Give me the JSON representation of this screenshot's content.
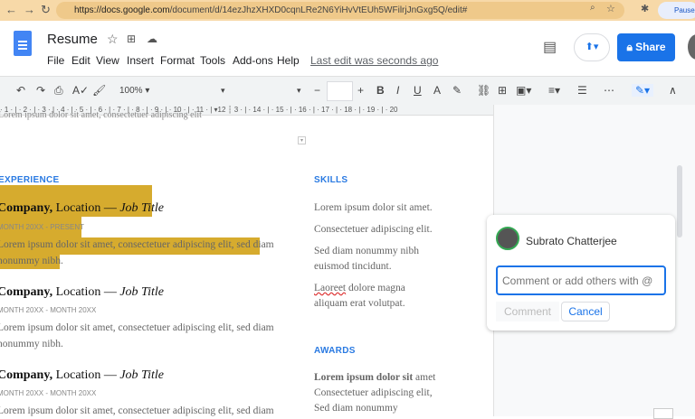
{
  "browser": {
    "url_host": "https://docs.google.com",
    "url_path": "/document/d/14ezJhzXHXD0cqnLRe2N6YiHvVtEUh5WFilrjJnGxg5Q/edit#",
    "profile": "Paused"
  },
  "doc": {
    "title": "Resume",
    "menu": [
      "File",
      "Edit",
      "View",
      "Insert",
      "Format",
      "Tools",
      "Add-ons",
      "Help"
    ],
    "last_edit": "Last edit was seconds ago",
    "share": "Share"
  },
  "toolbar": {
    "zoom": "100%",
    "minus": "−",
    "plus": "+",
    "bold": "B",
    "italic": "I",
    "underline": "U",
    "color": "A"
  },
  "ruler": "· 1 · | · 2 · | · 3 · | · 4 · | · 5 · | · 6 · | · 7 · | · 8 · | · 9 · | · 10 · | · 11 · | ▾12 ┆ 3 · | · 14 · | · 15 · | · 16 · | · 17 · | · 18 · | · 19 · | · 20",
  "page": {
    "top_line": "Lorem ipsum dolor sit amet, consectetuer adipiscing elit",
    "experience_heading": "EXPERIENCE",
    "jobs": [
      {
        "company": "Company,",
        "location": " Location — ",
        "title": "Job Title",
        "date": "MONTH 20XX - PRESENT",
        "desc1": "Lorem ipsum dolor sit amet, consectetuer adipiscing elit, sed diam",
        "desc2": "nonummy nibh."
      },
      {
        "company": "Company,",
        "location": " Location — ",
        "title": "Job Title",
        "date": "MONTH 20XX - MONTH 20XX",
        "desc1": "Lorem ipsum dolor sit amet, consectetuer adipiscing elit, sed diam",
        "desc2": "nonummy nibh."
      },
      {
        "company": "Company,",
        "location": " Location — ",
        "title": "Job Title",
        "date": "MONTH 20XX - MONTH 20XX",
        "desc1": "Lorem ipsum dolor sit amet, consectetuer adipiscing elit, sed diam",
        "desc2": ""
      }
    ],
    "skills_heading": "SKILLS",
    "skills": [
      "Lorem ipsum dolor sit amet.",
      "Consectetuer adipiscing elit.",
      "Sed diam nonummy nibh",
      "euismod tincidunt.",
      "Laoreet",
      "dolore magna",
      "aliquam erat volutpat."
    ],
    "awards_heading": "AWARDS",
    "awards": [
      "Lorem ipsum dolor sit",
      "amet",
      "Consectetuer adipiscing elit,",
      "Sed diam nonummy"
    ]
  },
  "comment": {
    "user": "Subrato Chatterjee",
    "placeholder": "Comment or add others with @",
    "comment_btn": "Comment",
    "cancel_btn": "Cancel"
  },
  "colors": {
    "highlight": "#d6ab2e",
    "accent": "#1a73e8",
    "heading": "#2a7ae2"
  }
}
